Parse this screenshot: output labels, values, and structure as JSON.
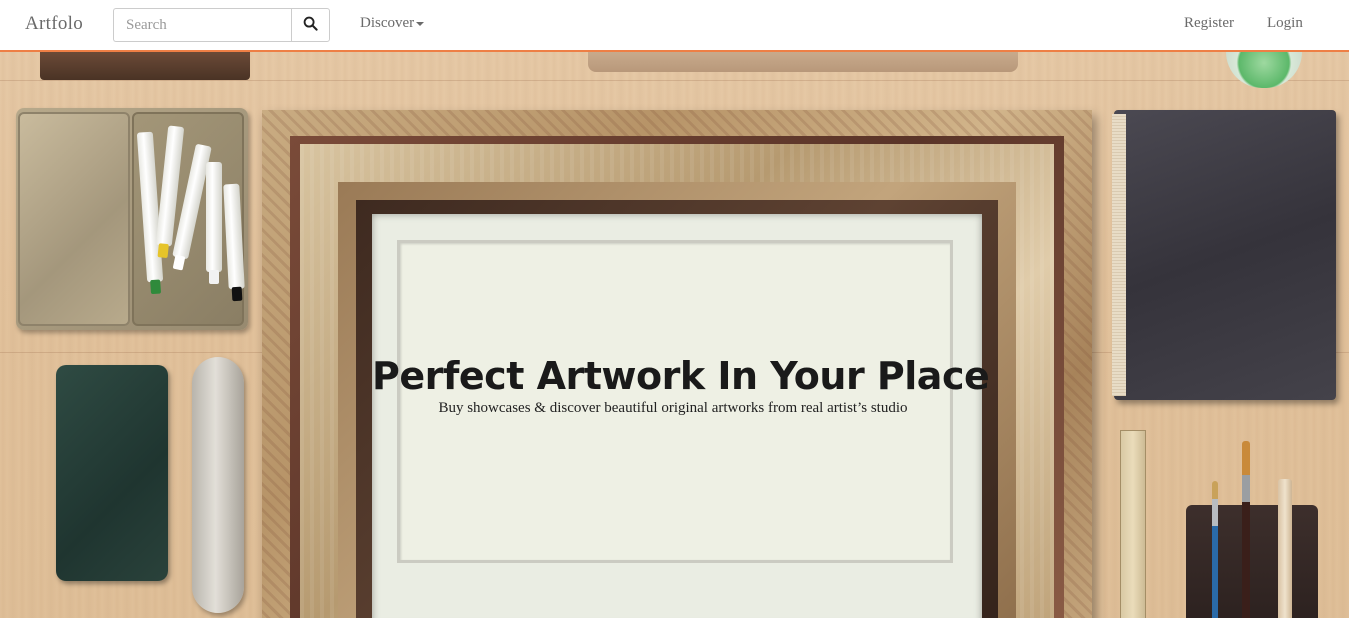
{
  "navbar": {
    "brand": "Artfolo",
    "search": {
      "placeholder": "Search",
      "value": ""
    },
    "discover_label": "Discover",
    "register_label": "Register",
    "login_label": "Login",
    "accent_color": "#ee7f45"
  },
  "hero": {
    "title": "Perfect Artwork In Your Place",
    "subtitle": "Buy showcases & discover beautiful original artworks from real artist’s studio"
  },
  "icons": {
    "search": "search-icon",
    "dropdown": "caret-down-icon"
  }
}
